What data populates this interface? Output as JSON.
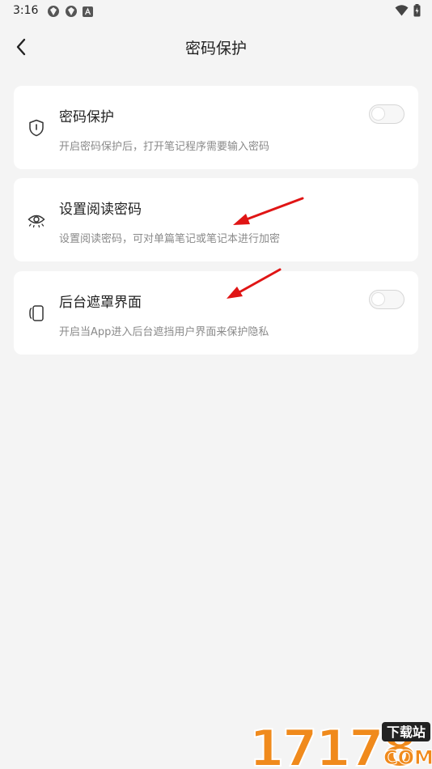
{
  "status_bar": {
    "time": "3:16"
  },
  "header": {
    "title": "密码保护"
  },
  "settings": [
    {
      "title": "密码保护",
      "description": "开启密码保护后，打开笔记程序需要输入密码",
      "icon": "shield-icon",
      "has_toggle": true,
      "enabled": false
    },
    {
      "title": "设置阅读密码",
      "description": "设置阅读密码，可对单篇笔记或笔记本进行加密",
      "icon": "eye-icon",
      "has_toggle": false
    },
    {
      "title": "后台遮罩界面",
      "description": "开启当App进入后台遮挡用户界面来保护隐私",
      "icon": "screen-mask-icon",
      "has_toggle": true,
      "enabled": false
    }
  ],
  "watermark": {
    "number": "17178",
    "tag": "下载站",
    "domain": "COM"
  },
  "colors": {
    "background": "#f4f4f4",
    "card": "#ffffff",
    "annotation_arrow": "#e01515",
    "watermark_orange": "#f08a1c"
  }
}
